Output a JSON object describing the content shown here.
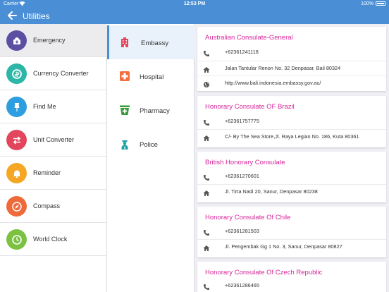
{
  "status": {
    "carrier": "Carrier",
    "time": "12:53 PM",
    "battery": "100%"
  },
  "nav": {
    "title": "Utilities"
  },
  "menu": [
    {
      "label": "Emergency",
      "icon": "ambulance-icon",
      "color": "#5a4fa3"
    },
    {
      "label": "Currency Converter",
      "icon": "currency-exchange-icon",
      "color": "#2bb6a8"
    },
    {
      "label": "Find Me",
      "icon": "pin-icon",
      "color": "#2d9fe0"
    },
    {
      "label": "Unit Converter",
      "icon": "swap-arrows-icon",
      "color": "#e2455c"
    },
    {
      "label": "Reminder",
      "icon": "bell-icon",
      "color": "#f5a623"
    },
    {
      "label": "Compass",
      "icon": "compass-icon",
      "color": "#ef6a3a"
    },
    {
      "label": "World Clock",
      "icon": "clock-icon",
      "color": "#7cc242"
    }
  ],
  "categories": [
    {
      "label": "Embassy",
      "icon": "building-icon",
      "color": "#e2455c"
    },
    {
      "label": "Hospital",
      "icon": "hospital-cross-icon",
      "color": "#f36e3c"
    },
    {
      "label": "Pharmacy",
      "icon": "pharmacy-icon",
      "color": "#3a9a3a"
    },
    {
      "label": "Police",
      "icon": "police-officer-icon",
      "color": "#1fa1a8"
    }
  ],
  "cards": [
    {
      "title": "Australian Consulate-General",
      "phone": "+62361241118",
      "address": "Jalan Tantular Renon No. 32 Denpasar, Bali 80324",
      "website": "http://www.bali.indonesia.embassy.gov.au/"
    },
    {
      "title": "Honorary Consulate OF Brazil",
      "phone": "+62361757775",
      "address": "C/- By The Sea Store,Jl. Raya Legian No. 186, Kuta 80361"
    },
    {
      "title": "British Honorary Consulate",
      "phone": "+62361270601",
      "address": "Jl. Tirta Nadi 20, Sanur, Denpasar 80238"
    },
    {
      "title": "Honorary Consulate Of Chile",
      "phone": "+62361281503",
      "address": "Jl. Pengembak Gg 1 No. 3, Sanur, Denpasar 80827"
    },
    {
      "title": "Honorary Consulate Of Czech Republic",
      "phone": "+62361286465"
    }
  ],
  "colors": {
    "accent": "#4a8fd6",
    "title_pink": "#d6249a"
  }
}
